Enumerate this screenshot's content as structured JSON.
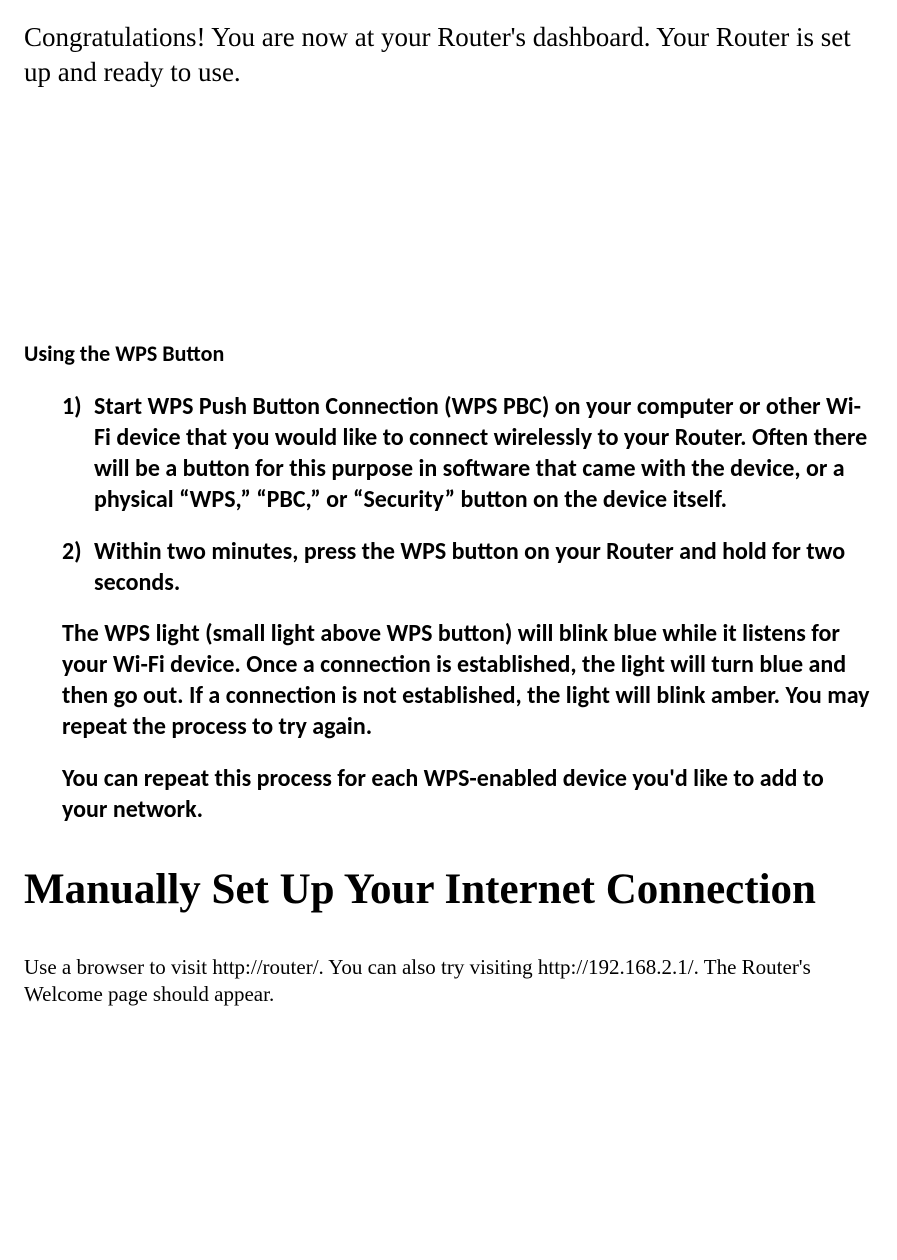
{
  "intro": "Congratulations! You are now at your Router's dashboard. Your Router is set up and ready to use.",
  "section_wps_title": "Using the WPS Button",
  "wps_step1_marker": "1)",
  "wps_step1": "Start WPS Push Button Connection (WPS PBC) on your computer or other Wi-Fi device that you would like to connect wirelessly to your Router. Often there will be a button for this purpose in software that came with the device, or a physical “WPS,” “PBC,” or “Security” button on the device itself.",
  "wps_step2_marker": "2)",
  "wps_step2": "Within two minutes, press the WPS button on your Router and hold for two seconds.",
  "wps_light_info": "The WPS light (small light above WPS button) will blink blue while it listens for your Wi-Fi device. Once a connection is established, the light will turn blue and then go out. If a connection is not established, the light will blink amber. You may repeat the process to try again.",
  "wps_repeat_info": "You can repeat this process for each WPS-enabled device you'd like to add to your network.",
  "manual_heading": "Manually Set Up Your Internet Connection",
  "manual_instruction": "Use a browser to visit http://router/. You can also try visiting http://192.168.2.1/. The Router's Welcome page should appear."
}
